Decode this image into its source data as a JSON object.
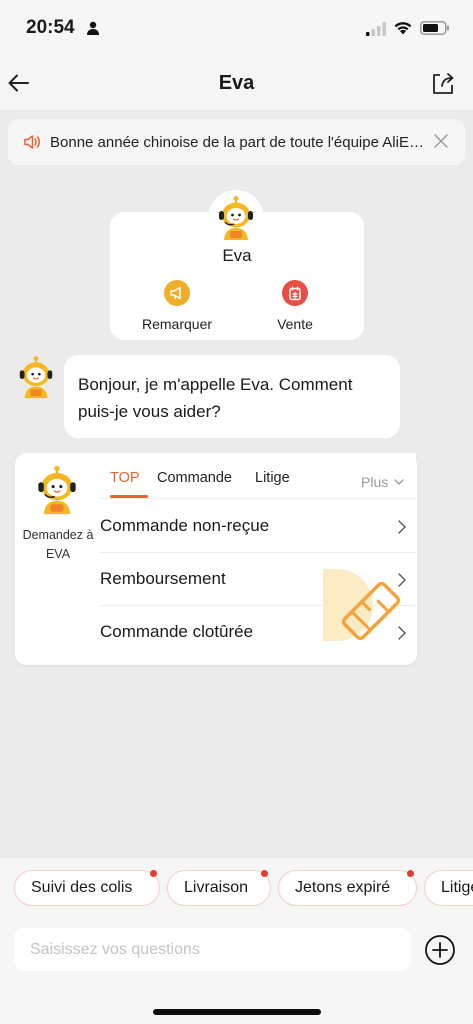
{
  "status_bar": {
    "time": "20:54"
  },
  "nav": {
    "title": "Eva"
  },
  "announcement": {
    "text": "Bonne année chinoise de la part de toute l'équipe AliExpress !"
  },
  "bot_card": {
    "name": "Eva",
    "actions": [
      {
        "label": "Remarquer",
        "icon": "megaphone-icon"
      },
      {
        "label": "Vente",
        "icon": "sale-tag-icon"
      }
    ]
  },
  "message": {
    "text": "Bonjour, je m'appelle Eva. Comment puis-je vous aider?"
  },
  "faq": {
    "ask_label": "Demandez à EVA",
    "tabs": [
      "TOP",
      "Commande",
      "Litige"
    ],
    "active_tab": "TOP",
    "more_label": "Plus",
    "items": [
      "Commande non-reçue",
      "Remboursement",
      "Commande clotûrée"
    ]
  },
  "quick_replies": [
    {
      "label": "Suivi des colis",
      "badge": true
    },
    {
      "label": "Livraison",
      "badge": true
    },
    {
      "label": "Jetons expiré",
      "badge": true
    },
    {
      "label": "Litige",
      "badge": false
    }
  ],
  "input": {
    "placeholder": "Saisissez vos questions",
    "value": ""
  },
  "colors": {
    "accent": "#e8622e",
    "badge": "#e83a30",
    "bot_yellow": "#f5b823",
    "remarquer": "#f0ad2c",
    "vente": "#ea4d46"
  }
}
